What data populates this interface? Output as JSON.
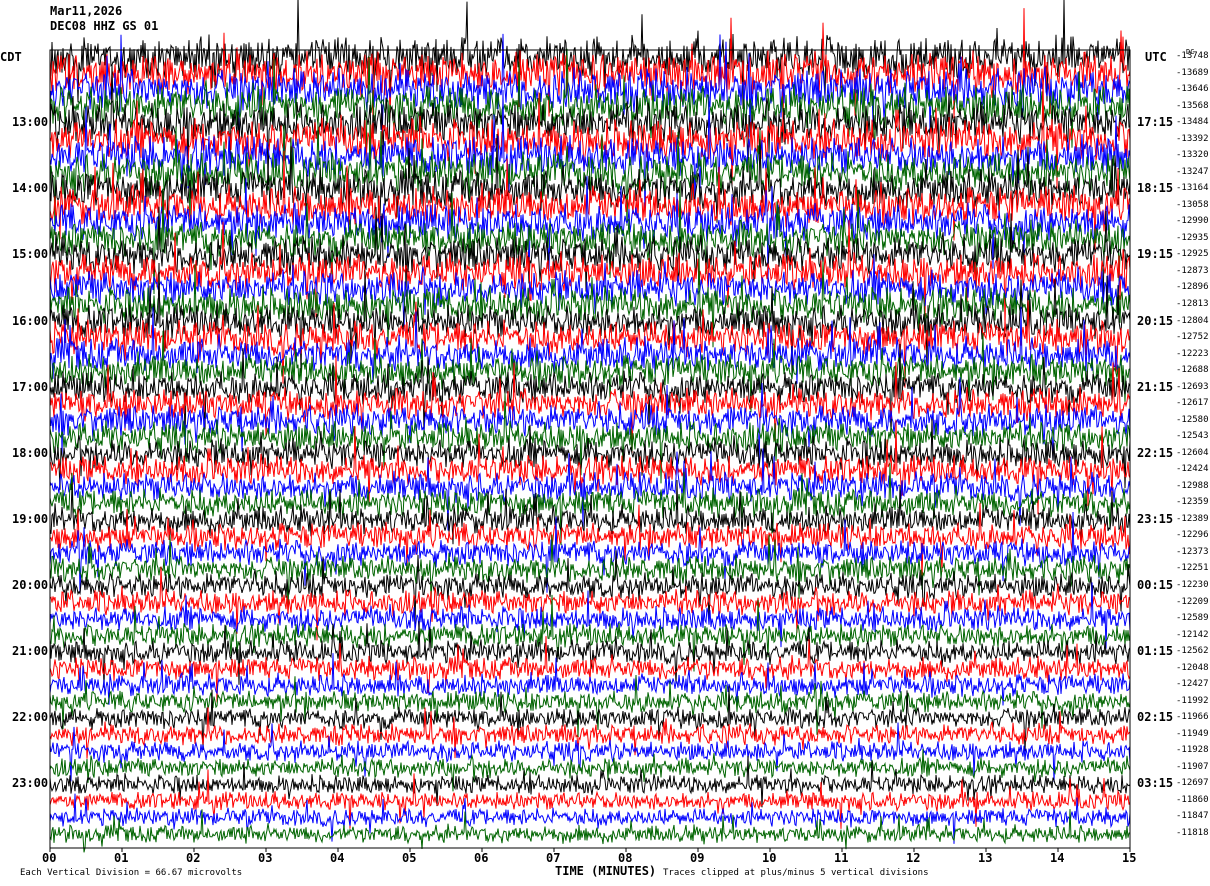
{
  "header": {
    "date": "Mar11,2026",
    "station": "DEC08 HHZ GS 01"
  },
  "left_axis": {
    "title": "CDT",
    "labels": [
      "13:00",
      "14:00",
      "15:00",
      "16:00",
      "17:00",
      "18:00",
      "19:00",
      "20:00",
      "21:00",
      "22:00",
      "23:00"
    ]
  },
  "right_axis": {
    "title": "UTC",
    "labels": [
      "17:15",
      "18:15",
      "19:15",
      "20:15",
      "21:15",
      "22:15",
      "23:15",
      "00:15",
      "01:15",
      "02:15",
      "03:15"
    ],
    "dc_label": "DC",
    "dc_offsets": [
      "-13748",
      "-13689",
      "-13646",
      "-13568",
      "-13484",
      "-13392",
      "-13320",
      "-13247",
      "-13164",
      "-13058",
      "-12990",
      "-12935",
      "-12925",
      "-12873",
      "-12896",
      "-12813",
      "-12804",
      "-12752",
      "-12223",
      "-12688",
      "-12693",
      "-12617",
      "-12580",
      "-12543",
      "-12604",
      "-12424",
      "-12988",
      "-12359",
      "-12389",
      "-12296",
      "-12373",
      "-12251",
      "-12230",
      "-12209",
      "-12589",
      "-12142",
      "-12562",
      "-12048",
      "-12427",
      "-11992",
      "-11966",
      "-11949",
      "-11928",
      "-11907",
      "-12697",
      "-11860",
      "-11847",
      "-11818"
    ]
  },
  "footer": {
    "scale": "Each Vertical Division =   66.67 microvolts",
    "xlabel": "TIME (MINUTES)",
    "clip_note": "Traces clipped at plus/minus 5 vertical divisions"
  },
  "chart_data": {
    "type": "line",
    "title": "",
    "xlabel": "TIME (MINUTES)",
    "xlim": [
      0,
      15
    ],
    "x_ticks": [
      "00",
      "01",
      "02",
      "03",
      "04",
      "05",
      "06",
      "07",
      "08",
      "09",
      "10",
      "11",
      "12",
      "13",
      "14",
      "15"
    ],
    "rows": 48,
    "row_minutes": 15,
    "trace_colors": [
      "#000000",
      "#ff0000",
      "#0000ff",
      "#006400"
    ],
    "clip_divisions": 5
  }
}
